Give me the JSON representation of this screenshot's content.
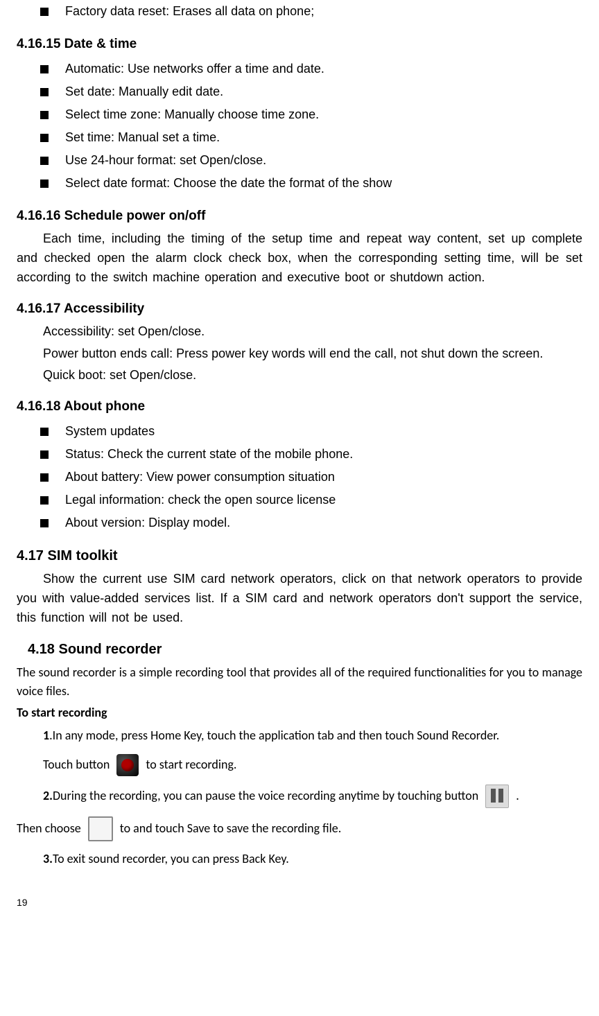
{
  "top_bullets": [
    "Factory data reset: Erases all data on phone;"
  ],
  "s41615": {
    "heading": "4.16.15  Date & time",
    "items": [
      "Automatic: Use networks offer a time and date.",
      "Set date: Manually edit date.",
      "Select time zone: Manually choose time zone.",
      "Set time: Manual set a time.",
      "Use 24-hour format: set Open/close.",
      "Select date format: Choose the date the format of the show"
    ]
  },
  "s41616": {
    "heading": "4.16.16  Schedule power on/off",
    "para": "Each time, including the timing of the setup time and repeat way content, set up complete and checked open the alarm clock check box, when the corresponding setting time, will be set according to the switch machine operation and executive boot or shutdown action."
  },
  "s41617": {
    "heading": "4.16.17  Accessibility",
    "p1": "Accessibility: set Open/close.",
    "p2": "Power button ends call: Press power key words will end the call, not shut down the screen.",
    "p3": "Quick boot: set Open/close."
  },
  "s41618": {
    "heading": "4.16.18  About phone",
    "items": [
      "System updates",
      "Status: Check the current state of the mobile phone.",
      "About battery: View power consumption situation",
      "Legal information: check the open source license",
      "About version: Display model."
    ]
  },
  "s417": {
    "heading": "4.17 SIM toolkit",
    "para": "Show the current use SIM card network operators, click on that network operators to provide you with value-added services list. If a SIM card and network operators don't support the service, this function will not be used."
  },
  "s418": {
    "heading": "4.18 Sound recorder",
    "intro": "The sound recorder is a simple recording tool that provides all of the required functionalities for you to manage voice files.",
    "tostart": "To start recording",
    "step1_a": "1",
    "step1_b": ".In any mode, press Home Key, touch the application tab and then touch Sound Recorder.",
    "touch_pre": "Touch button",
    "touch_post": "to start recording.",
    "step2_a": "2.",
    "step2_b": "During the recording, you can pause the voice recording anytime by touching button",
    "step2_dot": ".",
    "then_pre": "Then choose",
    "then_post": "to and touch Save to save the recording file.",
    "step3_a": "3.",
    "step3_b": "To exit sound recorder, you can press Back Key."
  },
  "page_number": "19"
}
